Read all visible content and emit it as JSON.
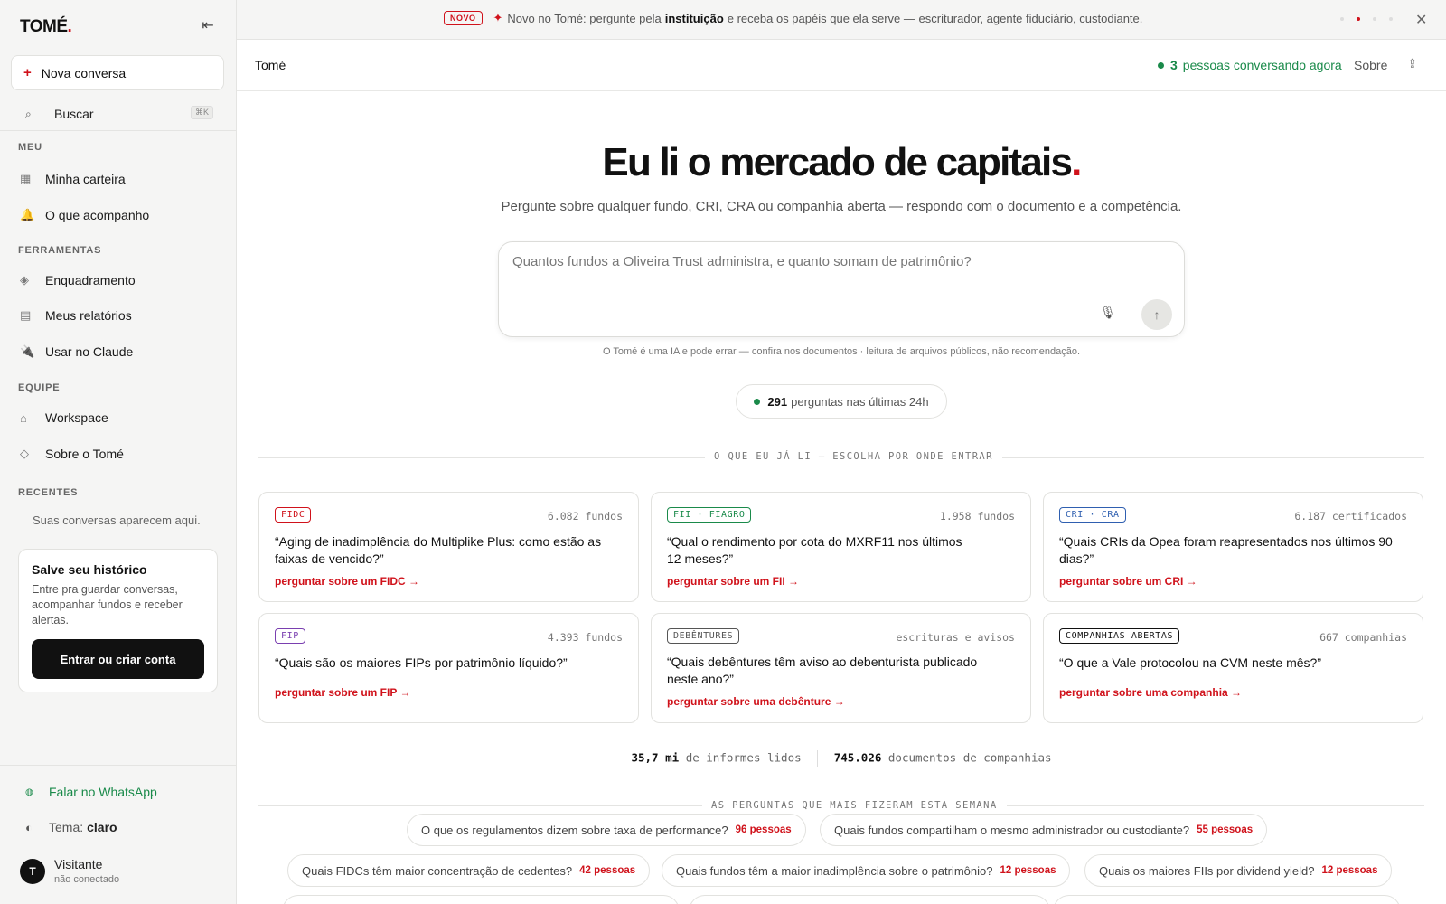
{
  "sidebar": {
    "logo": "TOMÉ",
    "logo_dot": ".",
    "collapse_icon": "collapse-left-icon",
    "new_chat": "Nova conversa",
    "search": {
      "label": "Buscar",
      "shortcut": "⌘K"
    },
    "sections": {
      "meu": "MEU",
      "ferramentas": "FERRAMENTAS",
      "equipe": "EQUIPE",
      "recentes": "RECENTES"
    },
    "items": [
      {
        "label": "Minha carteira",
        "icon": "grid-icon"
      },
      {
        "label": "O que acompanho",
        "icon": "bell-icon"
      },
      {
        "label": "Enquadramento",
        "icon": "diamond-icon"
      },
      {
        "label": "Meus relatórios",
        "icon": "list-icon"
      },
      {
        "label": "Usar no Claude",
        "icon": "plug-icon"
      },
      {
        "label": "Workspace",
        "icon": "home-icon"
      },
      {
        "label": "Sobre o Tomé",
        "icon": "diamond-outline-icon"
      }
    ],
    "recent_empty": "Suas conversas aparecem aqui.",
    "save_card": {
      "title": "Salve seu histórico",
      "text": "Entre pra guardar conversas, acompanhar fundos e receber alertas.",
      "button": "Entrar ou criar conta"
    },
    "whatsapp": "Falar no WhatsApp",
    "theme_label": "Tema:",
    "theme_value": "claro",
    "user": {
      "initial": "T",
      "name": "Visitante",
      "status": "não conectado"
    }
  },
  "banner": {
    "badge": "NOVO",
    "text_before": "Novo no Tomé: pergunte pela",
    "text_bold": "instituição",
    "text_after": "e receba os papéis que ela serve — escriturador, agente fiduciário, custodiante.",
    "slides": 5,
    "active_slide": 2
  },
  "header": {
    "title": "Tomé",
    "online_count": "3",
    "online_text": "pessoas conversando agora",
    "about": "Sobre"
  },
  "hero": {
    "title": "Eu li o mercado de capitais",
    "title_dot": ".",
    "subtitle": "Pergunte sobre qualquer fundo, CRI, CRA ou companhia aberta — respondo com o documento e a competência.",
    "placeholder": "Quantos fundos a Oliveira Trust administra, e quanto somam de patrimônio?",
    "disclaimer": "O Tomé é uma IA e pode errar — confira nos documentos · leitura de arquivos públicos, não recomendação.",
    "stat_count": "291",
    "stat_text": "perguntas nas últimas 24h"
  },
  "catalog": {
    "heading": "O QUE EU JÁ LI — ESCOLHA POR ONDE ENTRAR",
    "cards": [
      {
        "tag": "FIDC",
        "tag_color": "#d0121b",
        "count": "6.082 fundos",
        "question": "“Aging de inadimplência do Multiplike Plus: como estão as faixas de vencido?”",
        "link": "perguntar sobre um FIDC →"
      },
      {
        "tag": "FII · FIAGRO",
        "tag_color": "#1a8a4a",
        "count": "1.958 fundos",
        "question": "“Qual o rendimento por cota do MXRF11 nos últimos 12 meses?”",
        "link": "perguntar sobre um FII →"
      },
      {
        "tag": "CRI · CRA",
        "tag_color": "#2f5fb0",
        "count": "6.187 certificados",
        "question": "“Quais CRIs da Opea foram reapresentados nos últimos 90 dias?”",
        "link": "perguntar sobre um CRI →"
      },
      {
        "tag": "FIP",
        "tag_color": "#7a3fb0",
        "count": "4.393 fundos",
        "question": "“Quais são os maiores FIPs por patrimônio líquido?”",
        "link": "perguntar sobre um FIP →"
      },
      {
        "tag": "DEBÊNTURES",
        "tag_color": "#555555",
        "count": "escrituras e avisos",
        "question": "“Quais debêntures têm aviso ao debenturista publicado neste ano?”",
        "link": "perguntar sobre uma debênture →"
      },
      {
        "tag": "COMPANHIAS ABERTAS",
        "tag_color": "#111111",
        "count": "667 companhias",
        "question": "“O que a Vale protocolou na CVM neste mês?”",
        "link": "perguntar sobre uma companhia →"
      }
    ],
    "totals": [
      {
        "value": "35,7 mi",
        "label": "de informes lidos"
      },
      {
        "value": "745.026",
        "label": "documentos de companhias"
      }
    ]
  },
  "popular": {
    "heading": "AS PERGUNTAS QUE MAIS FIZERAM ESTA SEMANA",
    "chips": [
      {
        "q": "O que os regulamentos dizem sobre taxa de performance?",
        "n": "96 pessoas"
      },
      {
        "q": "Quais fundos compartilham o mesmo administrador ou custodiante?",
        "n": "55 pessoas"
      },
      {
        "q": "Quais FIDCs têm maior concentração de cedentes?",
        "n": "42 pessoas"
      },
      {
        "q": "Quais fundos têm a maior inadimplência sobre o patrimônio?",
        "n": "12 pessoas"
      },
      {
        "q": "Quais os maiores FIIs por dividend yield?",
        "n": "12 pessoas"
      }
    ]
  },
  "colors": {
    "accent": "#d0121b",
    "online": "#1a8a4a"
  }
}
